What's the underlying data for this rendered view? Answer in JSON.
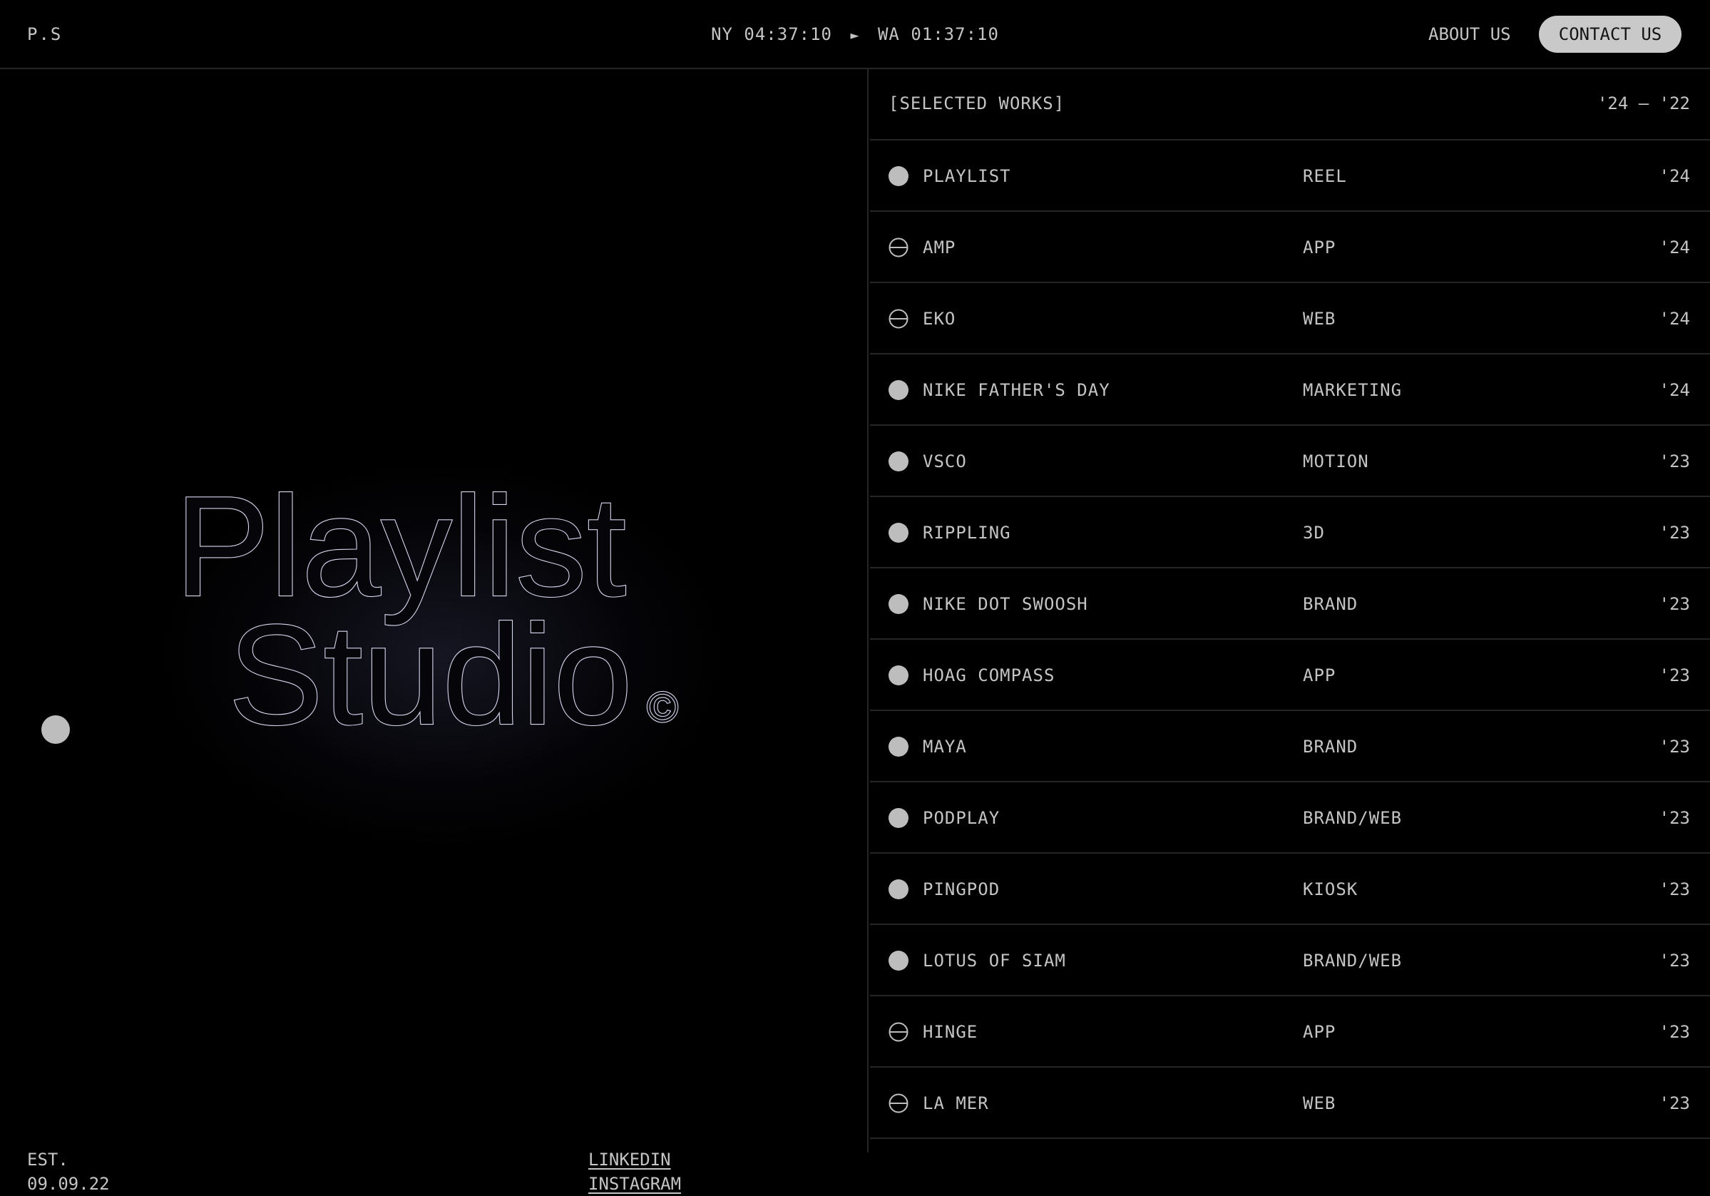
{
  "header": {
    "brand": "P.S",
    "clock_ny": "NY 04:37:10",
    "clock_arrow": "►",
    "clock_wa": "WA 01:37:10",
    "about_label": "ABOUT US",
    "contact_label": "CONTACT US"
  },
  "hero": {
    "logo_line1": "Playlist",
    "logo_line2": "Studio",
    "logo_mark": "©"
  },
  "footer": {
    "est_label": "EST.",
    "est_date": "09.09.22",
    "linkedin": "LINKEDIN",
    "instagram": "INSTAGRAM"
  },
  "works": {
    "title": "[SELECTED WORKS]",
    "range": "'24 — '22",
    "items": [
      {
        "name": "PLAYLIST",
        "category": "REEL",
        "year": "'24",
        "icon": "filled-dot-icon"
      },
      {
        "name": "AMP",
        "category": "APP",
        "year": "'24",
        "icon": "minus-circle-icon"
      },
      {
        "name": "EKO",
        "category": "WEB",
        "year": "'24",
        "icon": "minus-circle-icon"
      },
      {
        "name": "NIKE FATHER'S DAY",
        "category": "MARKETING",
        "year": "'24",
        "icon": "filled-dot-icon"
      },
      {
        "name": "VSCO",
        "category": "MOTION",
        "year": "'23",
        "icon": "filled-dot-icon"
      },
      {
        "name": "RIPPLING",
        "category": "3D",
        "year": "'23",
        "icon": "filled-dot-icon"
      },
      {
        "name": "NIKE DOT SWOOSH",
        "category": "BRAND",
        "year": "'23",
        "icon": "filled-dot-icon"
      },
      {
        "name": "HOAG COMPASS",
        "category": "APP",
        "year": "'23",
        "icon": "filled-dot-icon"
      },
      {
        "name": "MAYA",
        "category": "BRAND",
        "year": "'23",
        "icon": "filled-dot-icon"
      },
      {
        "name": "PODPLAY",
        "category": "BRAND/WEB",
        "year": "'23",
        "icon": "filled-dot-icon"
      },
      {
        "name": "PINGPOD",
        "category": "KIOSK",
        "year": "'23",
        "icon": "filled-dot-icon"
      },
      {
        "name": "LOTUS OF SIAM",
        "category": "BRAND/WEB",
        "year": "'23",
        "icon": "filled-dot-icon"
      },
      {
        "name": "HINGE",
        "category": "APP",
        "year": "'23",
        "icon": "minus-circle-icon"
      },
      {
        "name": "LA MER",
        "category": "WEB",
        "year": "'23",
        "icon": "minus-circle-icon"
      }
    ]
  },
  "colors": {
    "background": "#000000",
    "text": "#c4c4c4",
    "divider": "#262626",
    "button_bg": "#c9c9c9",
    "button_text": "#141414"
  }
}
